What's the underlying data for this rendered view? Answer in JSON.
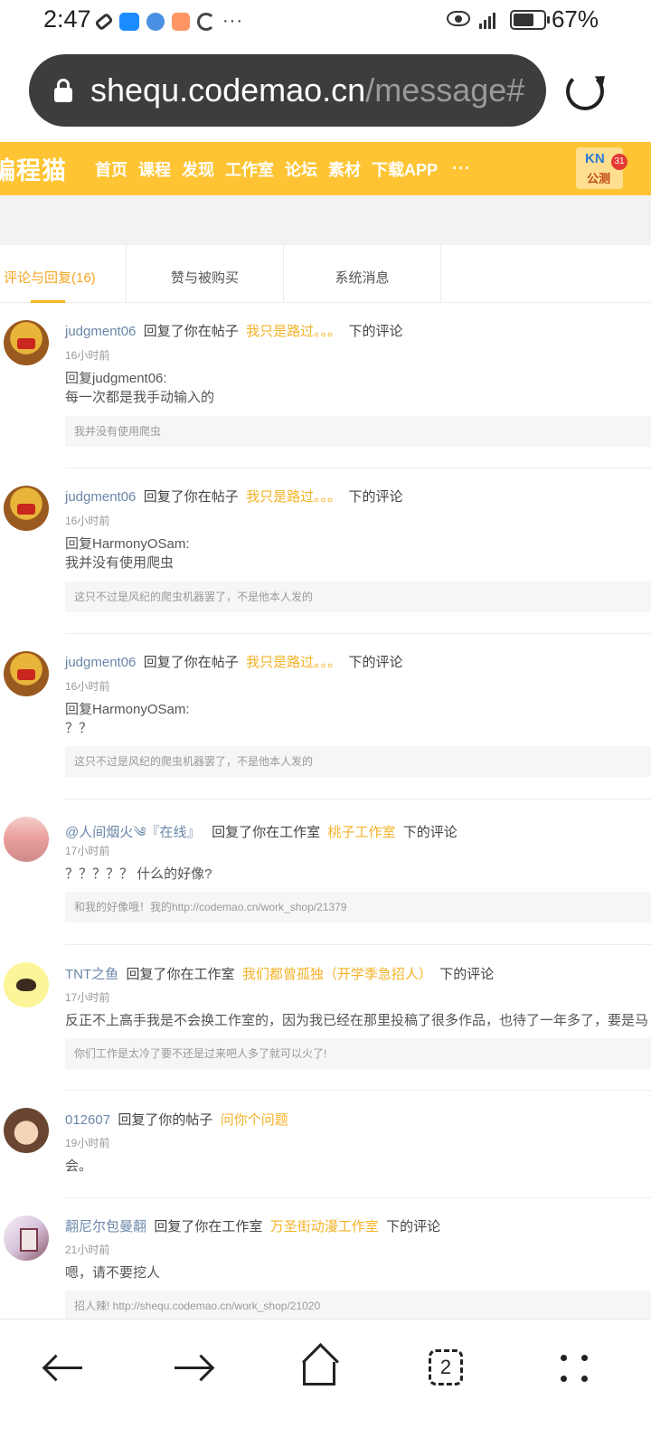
{
  "status_bar": {
    "time": "2:47",
    "battery_pct": "67%"
  },
  "url_bar": {
    "host": "shequ.codemao.cn",
    "path": "/message#"
  },
  "site": {
    "logo": "编程猫",
    "nav": [
      "首页",
      "课程",
      "发现",
      "工作室",
      "论坛",
      "素材",
      "下载APP"
    ],
    "more": "···",
    "user_chip": {
      "line1": "KN",
      "line2": "公测"
    },
    "notify_count": "31"
  },
  "tabs": [
    "评论与回复(16)",
    "赞与被购买",
    "系统消息"
  ],
  "messages": [
    {
      "user": "judgment06",
      "action": "回复了你在帖子",
      "target": "我只是路过。。。",
      "suffix": "下的评论",
      "time": "16小时前",
      "body": [
        "回复judgment06:",
        "每一次都是我手动输入的"
      ],
      "quote": "我并没有使用爬虫"
    },
    {
      "user": "judgment06",
      "action": "回复了你在帖子",
      "target": "我只是路过。。。",
      "suffix": "下的评论",
      "time": "16小时前",
      "body": [
        "回复HarmonyOSam:",
        "我并没有使用爬虫"
      ],
      "quote": "这只不过是风纪的爬虫机器罢了，不是他本人发的"
    },
    {
      "user": "judgment06",
      "action": "回复了你在帖子",
      "target": "我只是路过。。。",
      "suffix": "下的评论",
      "time": "16小时前",
      "body": [
        "回复HarmonyOSam:",
        "？？"
      ],
      "quote": "这只不过是风纪的爬虫机器罢了，不是他本人发的"
    },
    {
      "user": "@人间烟火༄『在线』",
      "action": "回复了你在工作室",
      "target": "桃子工作室",
      "suffix": "下的评论",
      "time": "17小时前",
      "body": [
        "？？？？？ 什么的好像?"
      ],
      "quote": "和我的好像哦！我的http://codemao.cn/work_shop/21379"
    },
    {
      "user": "TNT之鱼",
      "action": "回复了你在工作室",
      "target": "我们都曾孤独（开学季急招人）",
      "suffix": "下的评论",
      "time": "17小时前",
      "body": [
        "反正不上高手我是不会换工作室的，因为我已经在那里投稿了很多作品，也待了一年多了，要是马"
      ],
      "quote": "你们工作是太冷了要不还是过来吧人多了就可以火了!"
    },
    {
      "user": "012607",
      "action": "回复了你的帖子",
      "target": "问你个问题",
      "suffix": "",
      "time": "19小时前",
      "body": [
        "会。"
      ],
      "quote": ""
    },
    {
      "user": "翿尼尔包曼翿",
      "action": "回复了你在工作室",
      "target": "万圣街动漫工作室",
      "suffix": "下的评论",
      "time": "21小时前",
      "body": [
        "嗯，请不要挖人"
      ],
      "quote": "招人辣! http://shequ.codemao.cn/work_shop/21020"
    }
  ],
  "bottom_nav": {
    "tab_count": "2"
  }
}
